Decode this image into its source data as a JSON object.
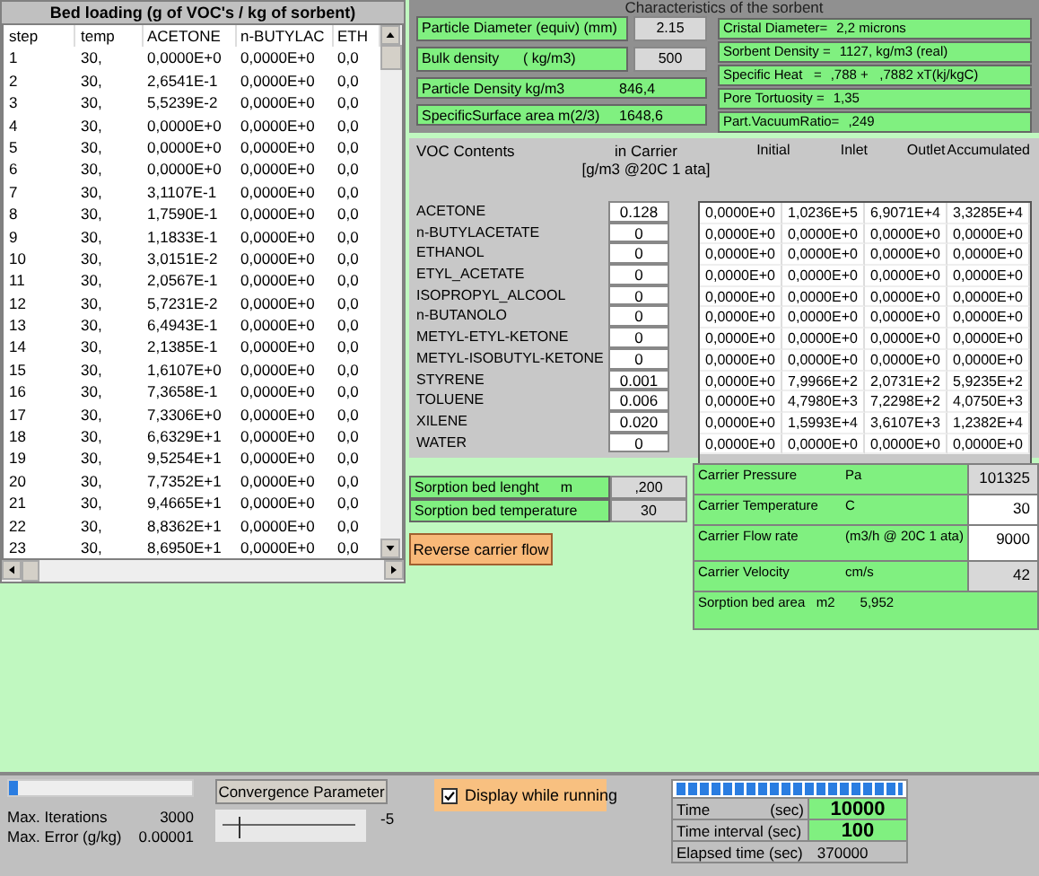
{
  "bed_loading": {
    "title": "Bed loading (g of VOC's / kg of sorbent)",
    "columns": [
      "step",
      "temp",
      "ACETONE",
      "n-BUTYLAC",
      "ETH"
    ],
    "rows": [
      [
        "1",
        "30,",
        "0,0000E+0",
        "0,0000E+0",
        "0,0"
      ],
      [
        "2",
        "30,",
        "2,6541E-1",
        "0,0000E+0",
        "0,0"
      ],
      [
        "3",
        "30,",
        "5,5239E-2",
        "0,0000E+0",
        "0,0"
      ],
      [
        "4",
        "30,",
        "0,0000E+0",
        "0,0000E+0",
        "0,0"
      ],
      [
        "5",
        "30,",
        "0,0000E+0",
        "0,0000E+0",
        "0,0"
      ],
      [
        "6",
        "30,",
        "0,0000E+0",
        "0,0000E+0",
        "0,0"
      ],
      [
        "7",
        "30,",
        "3,1107E-1",
        "0,0000E+0",
        "0,0"
      ],
      [
        "8",
        "30,",
        "1,7590E-1",
        "0,0000E+0",
        "0,0"
      ],
      [
        "9",
        "30,",
        "1,1833E-1",
        "0,0000E+0",
        "0,0"
      ],
      [
        "10",
        "30,",
        "3,0151E-2",
        "0,0000E+0",
        "0,0"
      ],
      [
        "11",
        "30,",
        "2,0567E-1",
        "0,0000E+0",
        "0,0"
      ],
      [
        "12",
        "30,",
        "5,7231E-2",
        "0,0000E+0",
        "0,0"
      ],
      [
        "13",
        "30,",
        "6,4943E-1",
        "0,0000E+0",
        "0,0"
      ],
      [
        "14",
        "30,",
        "2,1385E-1",
        "0,0000E+0",
        "0,0"
      ],
      [
        "15",
        "30,",
        "1,6107E+0",
        "0,0000E+0",
        "0,0"
      ],
      [
        "16",
        "30,",
        "7,3658E-1",
        "0,0000E+0",
        "0,0"
      ],
      [
        "17",
        "30,",
        "7,3306E+0",
        "0,0000E+0",
        "0,0"
      ],
      [
        "18",
        "30,",
        "6,6329E+1",
        "0,0000E+0",
        "0,0"
      ],
      [
        "19",
        "30,",
        "9,5254E+1",
        "0,0000E+0",
        "0,0"
      ],
      [
        "20",
        "30,",
        "7,7352E+1",
        "0,0000E+0",
        "0,0"
      ],
      [
        "21",
        "30,",
        "9,4665E+1",
        "0,0000E+0",
        "0,0"
      ],
      [
        "22",
        "30,",
        "8,8362E+1",
        "0,0000E+0",
        "0,0"
      ],
      [
        "23",
        "30,",
        "8,6950E+1",
        "0,0000E+0",
        "0,0"
      ]
    ]
  },
  "sorbent": {
    "title": "Characteristics of the sorbent",
    "inputs": [
      {
        "label": "Particle Diameter (equiv) (mm)",
        "value": "2.15"
      },
      {
        "label": "Bulk density      ( kg/m3)",
        "value": "500"
      }
    ],
    "computed": [
      {
        "label": "Particle Density kg/m3",
        "value": "846,4"
      },
      {
        "label": "SpecificSurface area m(2/3)",
        "value": "1648,6"
      }
    ],
    "properties": [
      {
        "label": "Cristal Diameter=",
        "value": "2,2 microns"
      },
      {
        "label": "Sorbent Density =",
        "value": "1127, kg/m3 (real)"
      },
      {
        "label": "Specific Heat   =",
        "value": ",788 +   ,7882 xT(kj/kgC)"
      },
      {
        "label": "Pore Tortuosity =",
        "value": "1,35"
      },
      {
        "label": "Part.VacuumRatio=",
        "value": ",249"
      }
    ]
  },
  "voc": {
    "headers": {
      "name": "VOC Contents",
      "carrier": "in Carrier",
      "carrier_unit": "[g/m3 @20C  1 ata]",
      "columns": [
        "Initial",
        "Inlet",
        "Outlet",
        "Accumulated"
      ]
    },
    "rows": [
      {
        "name": "ACETONE",
        "carrier": "0.128",
        "values": [
          "0,0000E+0",
          "1,0236E+5",
          "6,9071E+4",
          "3,3285E+4"
        ]
      },
      {
        "name": "n-BUTYLACETATE",
        "carrier": "0",
        "values": [
          "0,0000E+0",
          "0,0000E+0",
          "0,0000E+0",
          "0,0000E+0"
        ]
      },
      {
        "name": "ETHANOL",
        "carrier": "0",
        "values": [
          "0,0000E+0",
          "0,0000E+0",
          "0,0000E+0",
          "0,0000E+0"
        ]
      },
      {
        "name": "ETYL_ACETATE",
        "carrier": "0",
        "values": [
          "0,0000E+0",
          "0,0000E+0",
          "0,0000E+0",
          "0,0000E+0"
        ]
      },
      {
        "name": "ISOPROPYL_ALCOOL",
        "carrier": "0",
        "values": [
          "0,0000E+0",
          "0,0000E+0",
          "0,0000E+0",
          "0,0000E+0"
        ]
      },
      {
        "name": "n-BUTANOLO",
        "carrier": "0",
        "values": [
          "0,0000E+0",
          "0,0000E+0",
          "0,0000E+0",
          "0,0000E+0"
        ]
      },
      {
        "name": "METYL-ETYL-KETONE",
        "carrier": "0",
        "values": [
          "0,0000E+0",
          "0,0000E+0",
          "0,0000E+0",
          "0,0000E+0"
        ]
      },
      {
        "name": "METYL-ISOBUTYL-KETONE",
        "carrier": "0",
        "values": [
          "0,0000E+0",
          "0,0000E+0",
          "0,0000E+0",
          "0,0000E+0"
        ]
      },
      {
        "name": "STYRENE",
        "carrier": "0.001",
        "values": [
          "0,0000E+0",
          "7,9966E+2",
          "2,0731E+2",
          "5,9235E+2"
        ]
      },
      {
        "name": "TOLUENE",
        "carrier": "0.006",
        "values": [
          "0,0000E+0",
          "4,7980E+3",
          "7,2298E+2",
          "4,0750E+3"
        ]
      },
      {
        "name": "XILENE",
        "carrier": "0.020",
        "values": [
          "0,0000E+0",
          "1,5993E+4",
          "3,6107E+3",
          "1,2382E+4"
        ]
      },
      {
        "name": "WATER",
        "carrier": "0",
        "values": [
          "0,0000E+0",
          "0,0000E+0",
          "0,0000E+0",
          "0,0000E+0"
        ]
      }
    ]
  },
  "bed": [
    {
      "label": "Sorption bed lenght",
      "unit": "m",
      "value": ",200"
    },
    {
      "label": "Sorption bed temperature",
      "value": "30"
    }
  ],
  "reverse_button": "Reverse carrier flow",
  "carrier": [
    {
      "label": "Carrier Pressure",
      "unit": "Pa",
      "value": "101325",
      "editable": false
    },
    {
      "label": "Carrier Temperature",
      "unit": "C",
      "value": "30",
      "editable": true
    },
    {
      "label": "Carrier Flow rate",
      "unit": "(m3/h @ 20C 1 ata)",
      "value": "9000",
      "editable": true
    },
    {
      "label": "Carrier Velocity",
      "unit": "cm/s",
      "value": "42",
      "editable": false
    }
  ],
  "bed_area": {
    "label": "Sorption bed area   m2",
    "value": "5,952"
  },
  "status": {
    "iteration_progress": {
      "level": 0.05
    },
    "max_iterations": {
      "label": "Max. Iterations",
      "value": "3000"
    },
    "max_error": {
      "label": "Max. Error (g/kg)",
      "value": "0.00001"
    },
    "convergence_button": "Convergence Parameter",
    "convergence_slider": {
      "level": 0.1
    },
    "convergence_value": "-5",
    "display_while_running": {
      "label": "Display while running",
      "checked": true
    },
    "time_progress": {
      "level": 1
    },
    "time": {
      "label": "Time",
      "unit": "(sec)",
      "value": "10000"
    },
    "time_interval": {
      "label": "Time interval (sec)",
      "value": "100"
    },
    "elapsed": {
      "label": "Elapsed time (sec)",
      "value": "370000"
    }
  }
}
